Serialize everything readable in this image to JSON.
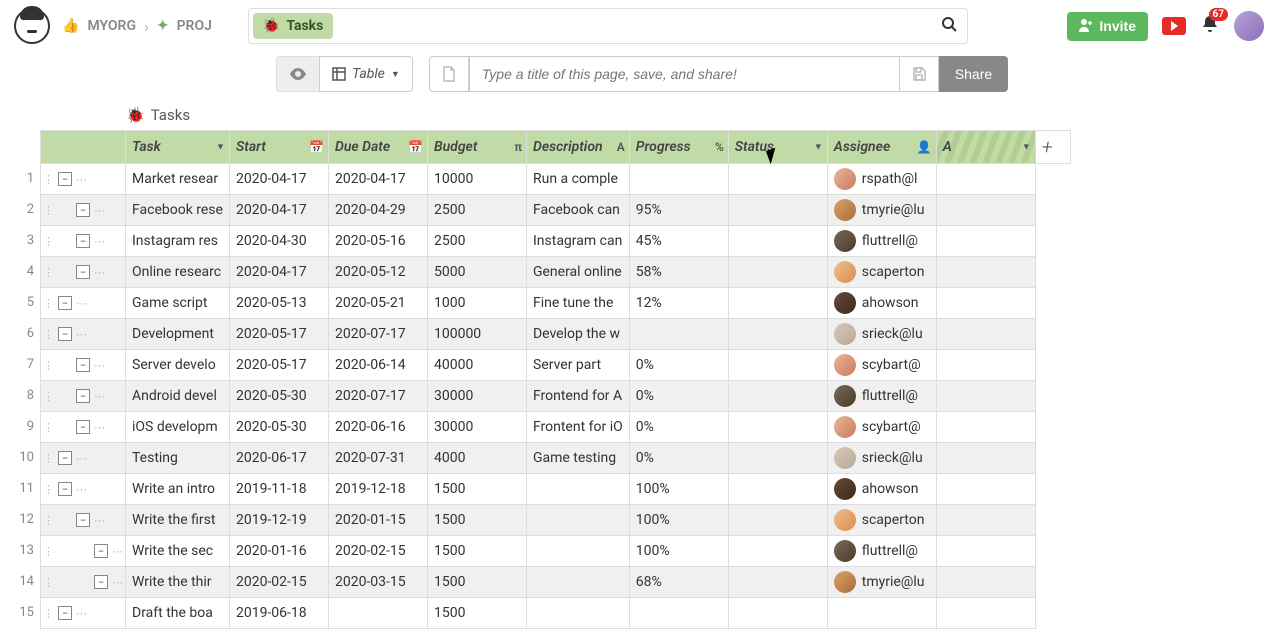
{
  "breadcrumb": {
    "org": "MYORG",
    "proj": "PROJ"
  },
  "search_chip": "Tasks",
  "invite_label": "Invite",
  "notification_count": "67",
  "toolbar": {
    "view_label": "Table",
    "title_placeholder": "Type a title of this page, save, and share!",
    "share_label": "Share"
  },
  "table_title": "Tasks",
  "columns": [
    {
      "label": "Task",
      "icon": "▾"
    },
    {
      "label": "Start",
      "icon": "📅"
    },
    {
      "label": "Due Date",
      "icon": "📅"
    },
    {
      "label": "Budget",
      "icon": "π"
    },
    {
      "label": "Description",
      "icon": "A"
    },
    {
      "label": "Progress",
      "icon": "%"
    },
    {
      "label": "Status",
      "icon": "▾"
    },
    {
      "label": "Assignee",
      "icon": "👤"
    },
    {
      "label": "A",
      "icon": "▾"
    }
  ],
  "rows": [
    {
      "n": 1,
      "indent": 0,
      "task": "Market resear",
      "start": "2020-04-17",
      "due": "2020-04-17",
      "budget": "10000",
      "desc": "Run a comple",
      "progress": "",
      "status": "",
      "assignee": "rspath@l",
      "av": "av0"
    },
    {
      "n": 2,
      "indent": 1,
      "task": "Facebook rese",
      "start": "2020-04-17",
      "due": "2020-04-29",
      "budget": "2500",
      "desc": "Facebook can",
      "progress": "95%",
      "status": "",
      "assignee": "tmyrie@lu",
      "av": "av1"
    },
    {
      "n": 3,
      "indent": 1,
      "task": "Instagram res",
      "start": "2020-04-30",
      "due": "2020-05-16",
      "budget": "2500",
      "desc": "Instagram can",
      "progress": "45%",
      "status": "",
      "assignee": "fluttrell@",
      "av": "av2"
    },
    {
      "n": 4,
      "indent": 1,
      "task": "Online researc",
      "start": "2020-04-17",
      "due": "2020-05-12",
      "budget": "5000",
      "desc": "General online",
      "progress": "58%",
      "status": "",
      "assignee": "scaperton",
      "av": "av3"
    },
    {
      "n": 5,
      "indent": 0,
      "task": "Game script",
      "start": "2020-05-13",
      "due": "2020-05-21",
      "budget": "1000",
      "desc": "Fine tune the",
      "progress": "12%",
      "status": "",
      "assignee": "ahowson",
      "av": "av4"
    },
    {
      "n": 6,
      "indent": 0,
      "task": "Development",
      "start": "2020-05-17",
      "due": "2020-07-17",
      "budget": "100000",
      "desc": "Develop the w",
      "progress": "",
      "status": "",
      "assignee": "srieck@lu",
      "av": "av5"
    },
    {
      "n": 7,
      "indent": 1,
      "task": "Server develo",
      "start": "2020-05-17",
      "due": "2020-06-14",
      "budget": "40000",
      "desc": "Server part",
      "progress": "0%",
      "status": "",
      "assignee": "scybart@",
      "av": "av0"
    },
    {
      "n": 8,
      "indent": 1,
      "task": "Android devel",
      "start": "2020-05-30",
      "due": "2020-07-17",
      "budget": "30000",
      "desc": "Frontend for A",
      "progress": "0%",
      "status": "",
      "assignee": "fluttrell@",
      "av": "av2"
    },
    {
      "n": 9,
      "indent": 1,
      "task": "iOS developm",
      "start": "2020-05-30",
      "due": "2020-06-16",
      "budget": "30000",
      "desc": "Frontent for iO",
      "progress": "0%",
      "status": "",
      "assignee": "scybart@",
      "av": "av0"
    },
    {
      "n": 10,
      "indent": 0,
      "task": "Testing",
      "start": "2020-06-17",
      "due": "2020-07-31",
      "budget": "4000",
      "desc": "Game testing",
      "progress": "0%",
      "status": "",
      "assignee": "srieck@lu",
      "av": "av5"
    },
    {
      "n": 11,
      "indent": 0,
      "task": "Write an intro",
      "start": "2019-11-18",
      "due": "2019-12-18",
      "budget": "1500",
      "desc": "",
      "progress": "100%",
      "status": "",
      "assignee": "ahowson",
      "av": "av4"
    },
    {
      "n": 12,
      "indent": 1,
      "task": "Write the first",
      "start": "2019-12-19",
      "due": "2020-01-15",
      "budget": "1500",
      "desc": "",
      "progress": "100%",
      "status": "",
      "assignee": "scaperton",
      "av": "av3"
    },
    {
      "n": 13,
      "indent": 2,
      "task": "Write the sec",
      "start": "2020-01-16",
      "due": "2020-02-15",
      "budget": "1500",
      "desc": "",
      "progress": "100%",
      "status": "",
      "assignee": "fluttrell@",
      "av": "av2"
    },
    {
      "n": 14,
      "indent": 2,
      "task": "Write the thir",
      "start": "2020-02-15",
      "due": "2020-03-15",
      "budget": "1500",
      "desc": "",
      "progress": "68%",
      "status": "",
      "assignee": "tmyrie@lu",
      "av": "av1"
    },
    {
      "n": 15,
      "indent": 0,
      "task": "Draft the boa",
      "start": "2019-06-18",
      "due": "",
      "budget": "1500",
      "desc": "",
      "progress": "",
      "status": "",
      "assignee": "",
      "av": ""
    }
  ]
}
